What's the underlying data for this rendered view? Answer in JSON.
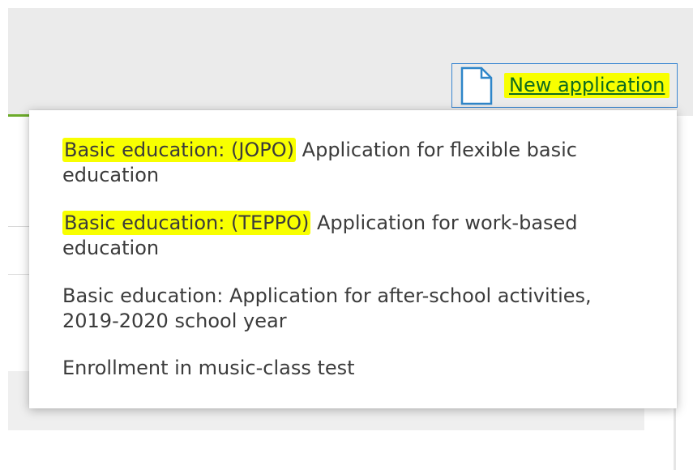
{
  "header": {
    "new_application_label": "New application",
    "new_application_icon": "document-icon"
  },
  "dropdown": {
    "items": [
      {
        "highlighted_prefix": "Basic education: (JOPO)",
        "rest": " Application for flexible basic education"
      },
      {
        "highlighted_prefix": "Basic education: (TEPPO)",
        "rest": " Application for work-based education"
      },
      {
        "text": "Basic education: Application for after-school activities, 2019-2020 school year"
      },
      {
        "text": "Enrollment in music-class test"
      }
    ]
  },
  "colors": {
    "highlight": "#f8ff00",
    "link": "#0f6b1f",
    "focus_border": "#3a86d2",
    "accent_green": "#6cab2a"
  }
}
